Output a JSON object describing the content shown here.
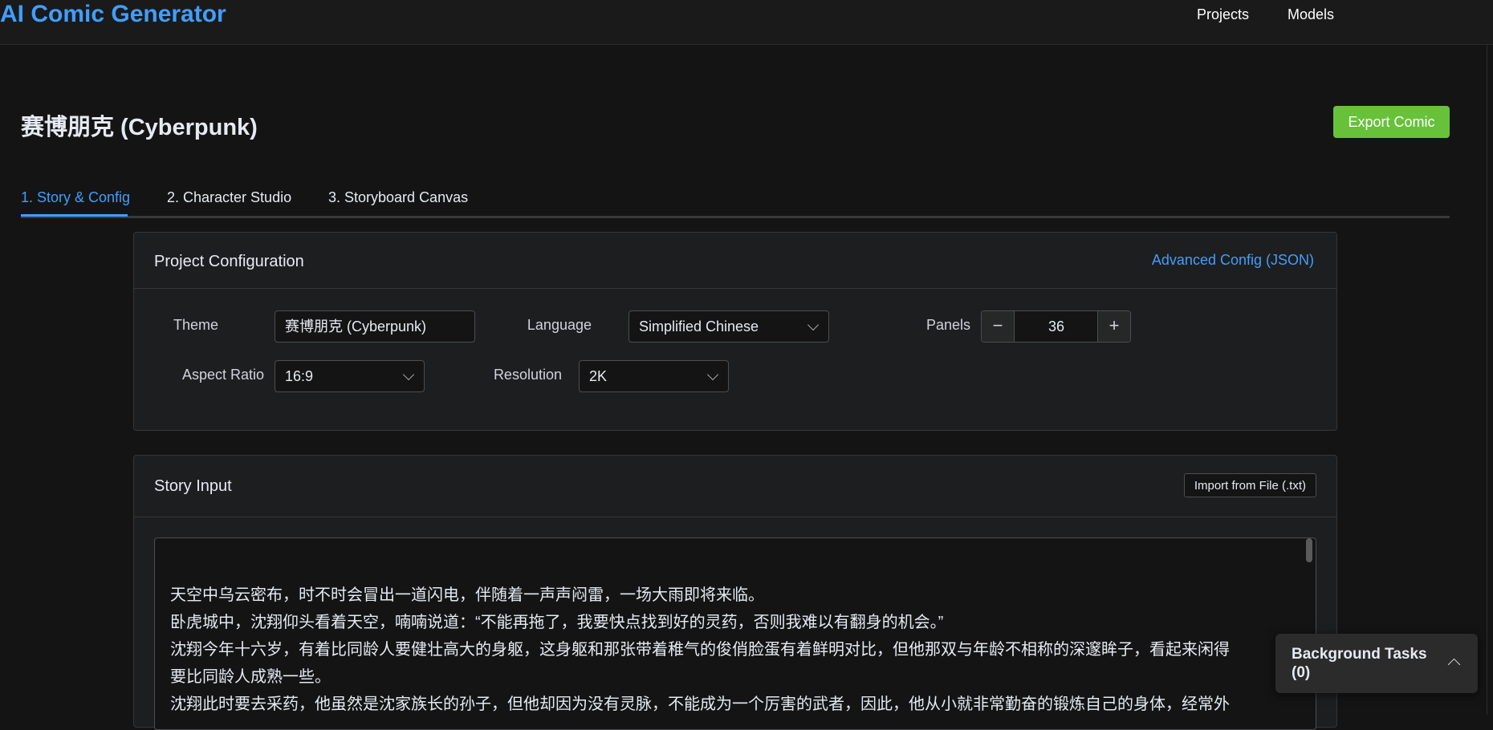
{
  "header": {
    "app_title": "AI Comic Generator",
    "nav": [
      "Projects",
      "Models"
    ]
  },
  "page": {
    "title": "赛博朋克 (Cyberpunk)",
    "export_label": "Export Comic"
  },
  "tabs": [
    {
      "label": "1. Story & Config",
      "active": true
    },
    {
      "label": "2. Character Studio",
      "active": false
    },
    {
      "label": "3. Storyboard Canvas",
      "active": false
    }
  ],
  "config": {
    "title": "Project Configuration",
    "advanced_link": "Advanced Config (JSON)",
    "theme_label": "Theme",
    "theme_value": "赛博朋克 (Cyberpunk)",
    "language_label": "Language",
    "language_value": "Simplified Chinese",
    "panels_label": "Panels",
    "panels_value": "36",
    "minus": "−",
    "plus": "+",
    "aspect_label": "Aspect Ratio",
    "aspect_value": "16:9",
    "resolution_label": "Resolution",
    "resolution_value": "2K"
  },
  "story": {
    "title": "Story Input",
    "import_label": "Import from File (.txt)",
    "lines": [
      "天空中乌云密布，时不时会冒出一道闪电，伴随着一声声闷雷，一场大雨即将来临。",
      "卧虎城中，沈翔仰头看着天空，喃喃说道：“不能再拖了，我要快点找到好的灵药，否则我难以有翻身的机会。”",
      "沈翔今年十六岁，有着比同龄人要健壮高大的身躯，这身躯和那张带着稚气的俊俏脸蛋有着鲜明对比，但他那双与年龄不相称的深邃眸子，看起来闲得",
      "要比同龄人成熟一些。",
      "沈翔此时要去采药，他虽然是沈家族长的孙子，但他却因为没有灵脉，不能成为一个厉害的武者，因此，他从小就非常勤奋的锻炼自己的身体，经常外"
    ]
  },
  "background_tasks": {
    "label": "Background Tasks (0)"
  },
  "colors": {
    "accent": "#409eff",
    "success": "#67c23a",
    "background": "#141414"
  }
}
